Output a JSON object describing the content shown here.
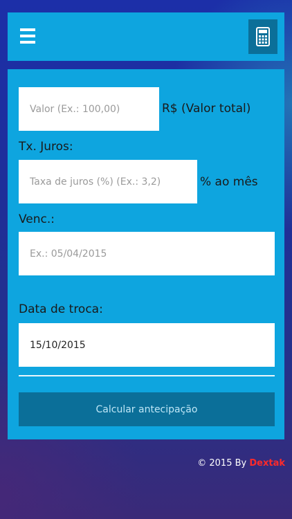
{
  "header": {
    "menu_icon": "hamburger-menu-icon",
    "calculator_icon": "calculator-icon"
  },
  "form": {
    "valor": {
      "placeholder": "Valor (Ex.: 100,00)",
      "value": "",
      "suffix": "R$ (Valor total)"
    },
    "juros": {
      "label": "Tx. Juros:",
      "placeholder": "Taxa de juros (%) (Ex.: 3,2)",
      "value": "",
      "suffix": "% ao mês"
    },
    "venc": {
      "label": "Venc.:",
      "placeholder": "Ex.: 05/04/2015",
      "value": ""
    },
    "troca": {
      "label": "Data de troca:",
      "placeholder": "",
      "value": "15/10/2015"
    },
    "submit_label": "Calcular antecipação"
  },
  "footer": {
    "copyright": "© 2015 By",
    "brand": "Dextak"
  },
  "colors": {
    "panel": "#0ea5df",
    "button": "#0b6f99",
    "brand": "#ff2a2a"
  }
}
